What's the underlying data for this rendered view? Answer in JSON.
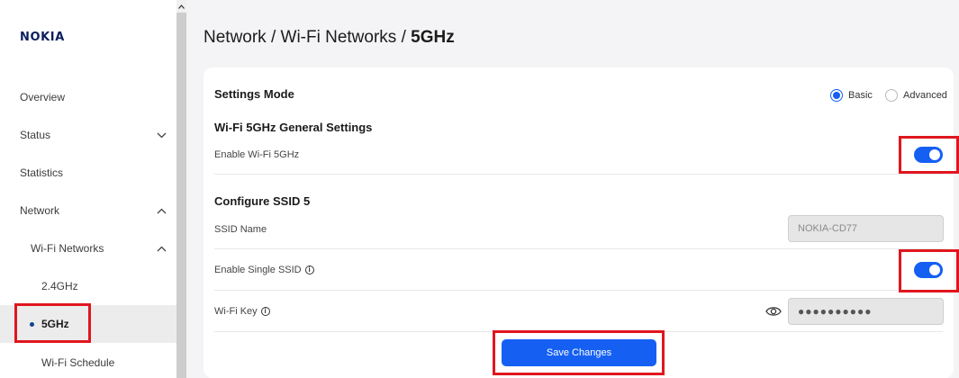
{
  "brand": {
    "logo_text": "NOKIA"
  },
  "sidebar": {
    "items": [
      {
        "label": "Overview"
      },
      {
        "label": "Status"
      },
      {
        "label": "Statistics"
      },
      {
        "label": "Network"
      },
      {
        "label": "Wi-Fi Networks"
      },
      {
        "label": "2.4GHz"
      },
      {
        "label": "5GHz"
      },
      {
        "label": "Wi-Fi Schedule"
      }
    ]
  },
  "breadcrumb": {
    "parent": "Network / Wi-Fi Networks / ",
    "current": "5GHz"
  },
  "settings_mode": {
    "title": "Settings Mode",
    "options": [
      "Basic",
      "Advanced"
    ],
    "selected": "Basic"
  },
  "general": {
    "title": "Wi-Fi 5GHz General Settings",
    "enable_label": "Enable Wi-Fi 5GHz",
    "enabled": true
  },
  "ssid": {
    "title": "Configure SSID 5",
    "name_label": "SSID Name",
    "name_placeholder": "NOKIA-CD77",
    "single_label": "Enable Single SSID",
    "single_enabled": true,
    "key_label": "Wi-Fi Key",
    "key_value": "●●●●●●●●●●"
  },
  "actions": {
    "save_label": "Save Changes"
  },
  "colors": {
    "accent": "#1560f3",
    "highlight": "#e0161e",
    "brand": "#0b1f5c"
  }
}
